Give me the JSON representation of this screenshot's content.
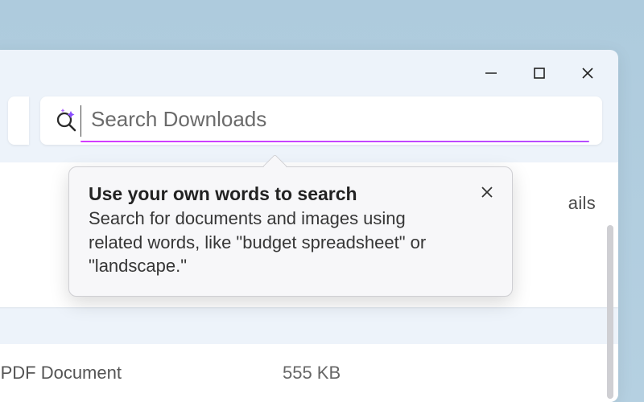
{
  "search": {
    "placeholder": "Search Downloads"
  },
  "tooltip": {
    "title": "Use your own words to search",
    "body": "Search for documents and images using related words, like \"budget spreadsheet\" or \"landscape.\""
  },
  "header": {
    "details_label_fragment": "ails"
  },
  "file_row": {
    "type_fragment": "ge PDF Document",
    "size": "555 KB"
  }
}
